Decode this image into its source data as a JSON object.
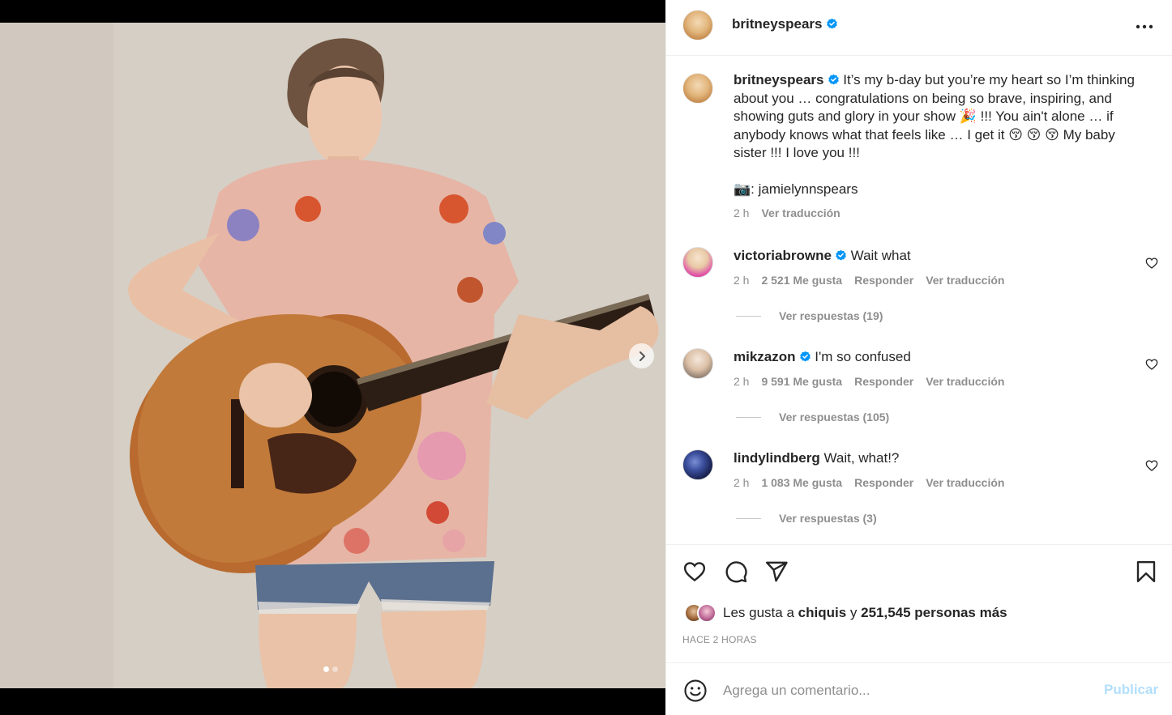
{
  "post": {
    "author": "britneyspears",
    "more_icon": "more-horizontal-icon",
    "carousel": {
      "slides": 2,
      "active_slide": 1
    }
  },
  "caption": {
    "author": "britneyspears",
    "text": "It’s my b-day but you’re my heart so I’m thinking about you … congratulations on being so brave, inspiring, and showing guts and glory in your show 🎉 !!! You ain't alone … if anybody knows what that feels like … I get it 😚 😚 😚 My baby sister !!! I love you !!!",
    "credit": "📷: jamielynnspears",
    "time": "2 h",
    "translate": "Ver traducción"
  },
  "comments": [
    {
      "author": "victoriabrowne",
      "verified": true,
      "text": "Wait what",
      "time": "2 h",
      "likes": "2 521 Me gusta",
      "reply": "Responder",
      "translate": "Ver traducción",
      "replies": "Ver respuestas (19)"
    },
    {
      "author": "mikzazon",
      "verified": true,
      "text": "I'm so confused",
      "time": "2 h",
      "likes": "9 591 Me gusta",
      "reply": "Responder",
      "translate": "Ver traducción",
      "replies": "Ver respuestas (105)"
    },
    {
      "author": "lindylindberg",
      "verified": false,
      "text": "Wait, what!?",
      "time": "2 h",
      "likes": "1 083 Me gusta",
      "reply": "Responder",
      "translate": "Ver traducción",
      "replies": "Ver respuestas (3)"
    }
  ],
  "actions": {
    "icons": [
      "heart-icon",
      "comment-icon",
      "share-icon",
      "bookmark-icon"
    ],
    "likes_prefix": "Les gusta a",
    "likes_user": "chiquis",
    "likes_joiner": "y",
    "likes_count": "251,545 personas más",
    "time_ago": "HACE 2 HORAS"
  },
  "add_comment": {
    "placeholder": "Agrega un comentario...",
    "publish": "Publicar",
    "emoji_icon": "smiley-icon"
  },
  "colors": {
    "verified": "#0095f6",
    "publish_disabled": "#b2dffc",
    "secondary_text": "#8e8e8e"
  }
}
